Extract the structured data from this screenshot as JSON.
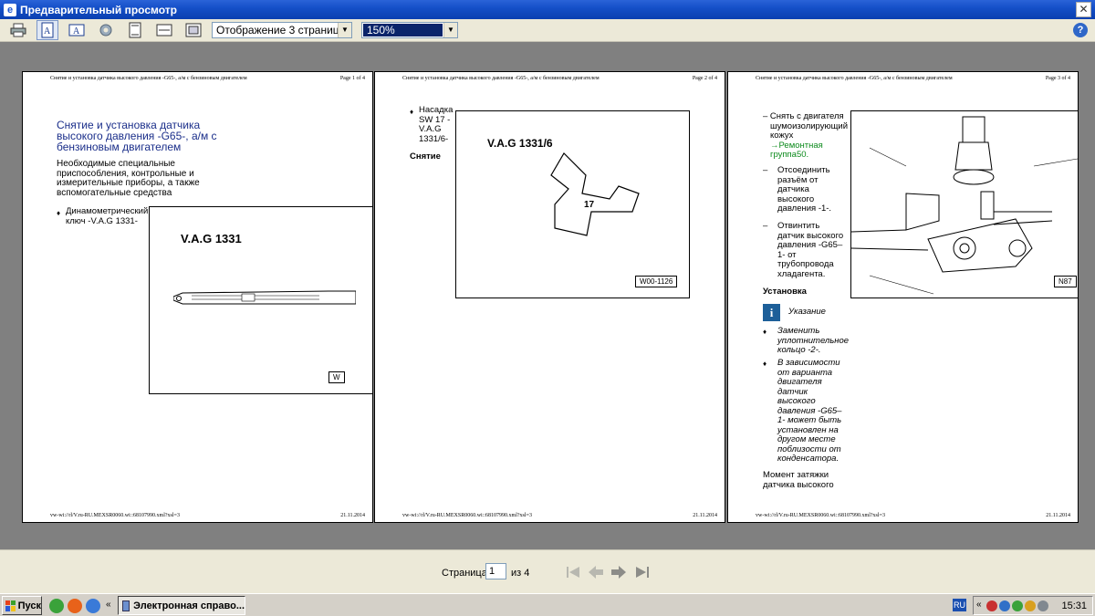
{
  "window": {
    "title": "Предварительный просмотр",
    "close_glyph": "✕"
  },
  "toolbar": {
    "view_mode": "Отображение 3 страниц",
    "zoom": "150%",
    "help_glyph": "?"
  },
  "pages": [
    {
      "header_left": "Снятие и установка датчика высокого давления -G65-, а/м с бензиновым двигателем",
      "header_right": "Page 1 of 4",
      "footer_left": "vw-wi://rl/V.ru-RU.MEXSR0060.wi::68107990.xml?xsl=3",
      "footer_right": "21.11.2014",
      "title_line1": "Снятие и установка датчика",
      "title_line2": "высокого давления -G65-, а/м с",
      "title_line3": "бензиновым двигателем",
      "sub_line1": "Необходимые специальные",
      "sub_line2": "приспособления, контрольные и",
      "sub_line3": "измерительные приборы, а также",
      "sub_line4": "вспомогательные средства",
      "item_line1": "Динамометрический",
      "item_line2": "ключ -V.A.G 1331-",
      "fig_label": "V.A.G 1331",
      "fig_code": "W"
    },
    {
      "header_left": "Снятие и установка датчика высокого давления -G65-, а/м с бензиновым двигателем",
      "header_right": "Page 2 of 4",
      "footer_left": "vw-wi://rl/V.ru-RU.MEXSR0060.wi::68107990.xml?xsl=3",
      "footer_right": "21.11.2014",
      "item_line1": "Насадка",
      "item_line2": "SW 17 -",
      "item_line3": "V.A.G",
      "item_line4": "1331/6-",
      "section": "Снятие",
      "fig_label": "V.A.G 1331/6",
      "fig_num": "17",
      "fig_code": "W00-1126"
    },
    {
      "header_left": "Снятие и установка датчика высокого давления -G65-, а/м с бензиновым двигателем",
      "header_right": "Page 3 of 4",
      "footer_left": "vw-wi://rl/V.ru-RU.MEXSR0060.wi::68107990.xml?xsl=3",
      "footer_right": "21.11.2014",
      "s1_line1": "– Снять с двигателя",
      "s1_line2": "шумоизолирующий",
      "s1_line3": "кожух",
      "s1_link1": "→Ремонтная",
      "s1_link2": "группа50.",
      "s2_line1": "Отсоединить",
      "s2_line2": "разъём от",
      "s2_line3": "датчика",
      "s2_line4": "высокого",
      "s2_line5": "давления -1-.",
      "s3_line1": "Отвинтить",
      "s3_line2": "датчик высокого",
      "s3_line3": "давления -G65–",
      "s3_line4": "1- от",
      "s3_line5": "трубопровода",
      "s3_line6": "хладагента.",
      "section": "Установка",
      "note_title": "Указание",
      "n1_line1": "Заменить",
      "n1_line2": "уплотнительное",
      "n1_line3": "кольцо -2-.",
      "n2_line1": "В зависимости",
      "n2_line2": "от варианта",
      "n2_line3": "двигателя",
      "n2_line4": "датчик",
      "n2_line5": "высокого",
      "n2_line6": "давления -G65–",
      "n2_line7": "1- может быть",
      "n2_line8": "установлен на",
      "n2_line9": "другом месте",
      "n2_line10": "поблизости от",
      "n2_line11": "конденсатора.",
      "torque_line1": "Момент затяжки",
      "torque_line2": "датчика высокого",
      "fig_code": "N87"
    }
  ],
  "navigation": {
    "page_label": "Страница",
    "current_page": "1",
    "of_label": "из 4"
  },
  "taskbar": {
    "start": "Пуск",
    "task": "Электронная справо...",
    "lang": "RU",
    "clock": "15:31",
    "chevron": "«"
  }
}
